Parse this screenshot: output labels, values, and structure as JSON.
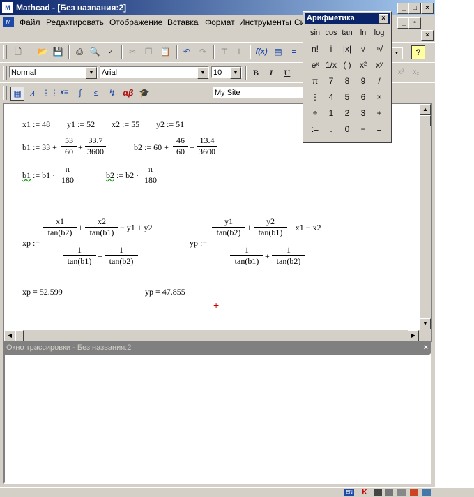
{
  "window": {
    "title": "Mathcad - [Без названия:2]",
    "app_icon": "mathcad-icon",
    "caption_buttons": [
      "_",
      "□",
      "×"
    ],
    "doc_buttons": [
      "_",
      "▫",
      "×"
    ]
  },
  "menu": {
    "items": [
      "Файл",
      "Редактировать",
      "Отображение",
      "Вставка",
      "Формат",
      "Инструменты",
      "Си"
    ]
  },
  "format_toolbar": {
    "style": "Normal",
    "font": "Arial",
    "size": "10",
    "bold": "B",
    "italic": "I",
    "underline": "U"
  },
  "math_toolbar": {
    "site": "My Site"
  },
  "worksheet": {
    "row1": [
      "x1 := 48",
      "y1 := 52",
      "x2 := 55",
      "y2 := 51"
    ],
    "b1_def": {
      "lhs": "b1 := 33 +",
      "f1n": "53",
      "f1d": "60",
      "plus": "+",
      "f2n": "33.7",
      "f2d": "3600"
    },
    "b2_def": {
      "lhs": "b2 := 60 +",
      "f1n": "46",
      "f1d": "60",
      "plus": "+",
      "f2n": "13.4",
      "f2d": "3600"
    },
    "b1_rad": {
      "lhs_name": "b1",
      "lhs": " := b1 ·",
      "n": "π",
      "d": "180"
    },
    "b2_rad": {
      "lhs_name": "b2",
      "lhs": " := b2 ·",
      "n": "π",
      "d": "180"
    },
    "xp_def": {
      "lhs": "xp :=",
      "t1n": "x1",
      "t1d": "tan(b2)",
      "t2n": "x2",
      "t2d": "tan(b1)",
      "tail": "− y1 + y2",
      "b1n": "1",
      "b1d": "tan(b1)",
      "b2n": "1",
      "b2d": "tan(b2)",
      "plus": "+"
    },
    "yp_def": {
      "lhs": "yp :=",
      "t1n": "y1",
      "t1d": "tan(b2)",
      "t2n": "y2",
      "t2d": "tan(b1)",
      "tail": "+ x1 − x2",
      "b1n": "1",
      "b1d": "tan(b1)",
      "b2n": "1",
      "b2d": "tan(b2)",
      "plus": "+"
    },
    "xp_result": "xp = 52.599",
    "yp_result": "yp = 47.855",
    "cursor": "+"
  },
  "trace": {
    "title": "Окно трассировки - Без названия:2",
    "close": "×"
  },
  "palette": {
    "title": "Арифметика",
    "close": "×",
    "row1": [
      "sin",
      "cos",
      "tan",
      "ln",
      "log"
    ],
    "row2": [
      "n!",
      "i",
      "|x|",
      "√",
      "ⁿ√"
    ],
    "row3": [
      "eˣ",
      "1/x",
      "( )",
      "x²",
      "xʸ"
    ],
    "row4": [
      "π",
      "7",
      "8",
      "9",
      "/"
    ],
    "row5": [
      "⋮",
      "4",
      "5",
      "6",
      "×"
    ],
    "row6": [
      "÷",
      "1",
      "2",
      "3",
      "+"
    ],
    "row7": [
      ":=",
      ".",
      "0",
      "−",
      "="
    ]
  },
  "colors": {
    "title_start": "#0a246a",
    "title_end": "#a6caf0",
    "face": "#d4d0c8",
    "cursor": "#cc0000",
    "wavy": "#0a9a0a"
  }
}
